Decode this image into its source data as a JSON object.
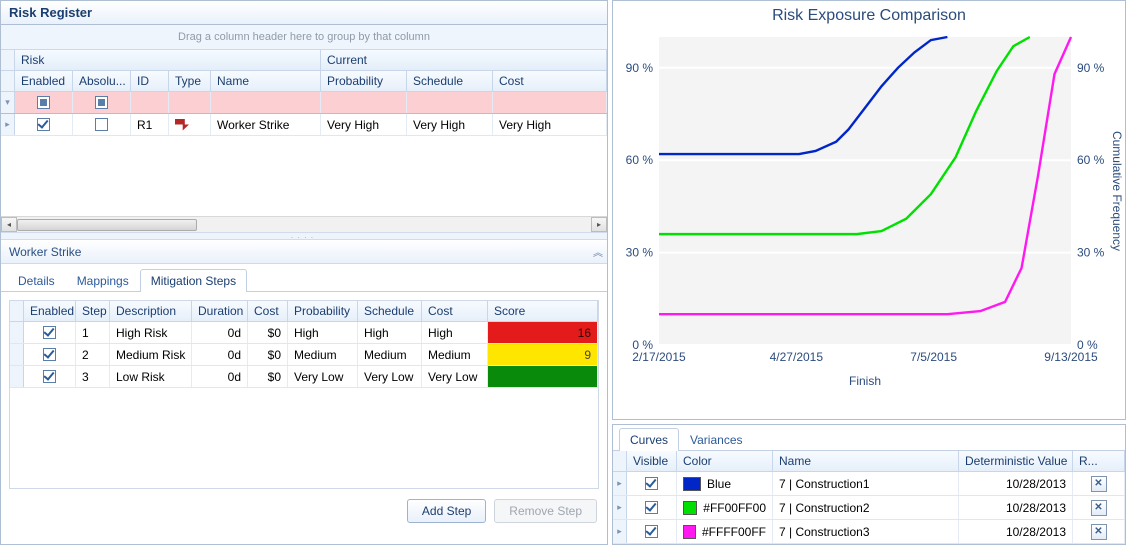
{
  "riskRegister": {
    "title": "Risk Register",
    "groupHint": "Drag a column header here to group by that column",
    "spanHeaders": {
      "risk": "Risk",
      "current": "Current"
    },
    "cols": {
      "enabled": "Enabled",
      "absolute": "Absolu...",
      "id": "ID",
      "type": "Type",
      "name": "Name",
      "probability": "Probability",
      "schedule": "Schedule",
      "cost": "Cost"
    },
    "rows": [
      {
        "enabled": true,
        "absolute": false,
        "id": "R1",
        "type": "thumb-down",
        "name": "Worker Strike",
        "probability": "Very High",
        "schedule": "Very High",
        "cost": "Very High"
      }
    ]
  },
  "detail": {
    "title": "Worker Strike",
    "tabs": {
      "details": "Details",
      "mappings": "Mappings",
      "mitigation": "Mitigation Steps"
    },
    "activeTab": "mitigation",
    "mitCols": {
      "enabled": "Enabled",
      "step": "Step",
      "description": "Description",
      "duration": "Duration",
      "cost": "Cost",
      "probability": "Probability",
      "schedule": "Schedule",
      "cost2": "Cost",
      "score": "Score"
    },
    "mitRows": [
      {
        "enabled": true,
        "step": "1",
        "description": "High Risk",
        "duration": "0d",
        "cost": "$0",
        "probability": "High",
        "schedule": "High",
        "cost2": "High",
        "score": "16",
        "scoreClass": "score-red"
      },
      {
        "enabled": true,
        "step": "2",
        "description": "Medium Risk",
        "duration": "0d",
        "cost": "$0",
        "probability": "Medium",
        "schedule": "Medium",
        "cost2": "Medium",
        "score": "9",
        "scoreClass": "score-yel"
      },
      {
        "enabled": true,
        "step": "3",
        "description": "Low Risk",
        "duration": "0d",
        "cost": "$0",
        "probability": "Very Low",
        "schedule": "Very Low",
        "cost2": "Very Low",
        "score": "",
        "scoreClass": "score-grn"
      }
    ],
    "buttons": {
      "add": "Add Step",
      "remove": "Remove Step"
    }
  },
  "chart": {
    "title": "Risk Exposure Comparison",
    "xlabel": "Finish",
    "ylabel_right": "Cumulative Frequency",
    "yticks": [
      "0 %",
      "30 %",
      "60 %",
      "90 %"
    ],
    "xticks": [
      "2/17/2015",
      "4/27/2015",
      "7/5/2015",
      "9/13/2015"
    ]
  },
  "chart_data": {
    "type": "line",
    "title": "Risk Exposure Comparison",
    "xlabel": "Finish",
    "ylabel": "Cumulative Frequency (%)",
    "ylim": [
      0,
      100
    ],
    "x_tick_labels": [
      "2/17/2015",
      "4/27/2015",
      "7/5/2015",
      "9/13/2015"
    ],
    "x_index_range": [
      0,
      100
    ],
    "series": [
      {
        "name": "7 | Construction1",
        "color": "#0026c7",
        "x": [
          0,
          34,
          38,
          43,
          46,
          50,
          54,
          58,
          62,
          66,
          70
        ],
        "y": [
          62,
          62,
          63,
          66,
          70,
          77,
          84,
          90,
          95,
          99,
          100
        ]
      },
      {
        "name": "7 | Construction2",
        "color": "#00e000",
        "x": [
          0,
          48,
          54,
          60,
          66,
          72,
          77,
          82,
          86,
          90
        ],
        "y": [
          36,
          36,
          37,
          41,
          49,
          61,
          76,
          89,
          97,
          100
        ]
      },
      {
        "name": "7 | Construction3",
        "color": "#ff19f0",
        "x": [
          0,
          70,
          78,
          84,
          88,
          92,
          96,
          100
        ],
        "y": [
          10,
          10,
          11,
          14,
          25,
          55,
          88,
          100
        ]
      }
    ]
  },
  "curves": {
    "tabs": {
      "curves": "Curves",
      "variances": "Variances"
    },
    "activeTab": "curves",
    "cols": {
      "visible": "Visible",
      "color": "Color",
      "name": "Name",
      "det": "Deterministic Value",
      "r": "R..."
    },
    "rows": [
      {
        "visible": true,
        "colorHex": "#0026c7",
        "colorLabel": "Blue",
        "name": "7 | Construction1",
        "det": "10/28/2013"
      },
      {
        "visible": true,
        "colorHex": "#00e000",
        "colorLabel": "#FF00FF00",
        "name": "7 | Construction2",
        "det": "10/28/2013"
      },
      {
        "visible": true,
        "colorHex": "#ff19f0",
        "colorLabel": "#FFFF00FF",
        "name": "7 | Construction3",
        "det": "10/28/2013"
      }
    ]
  }
}
